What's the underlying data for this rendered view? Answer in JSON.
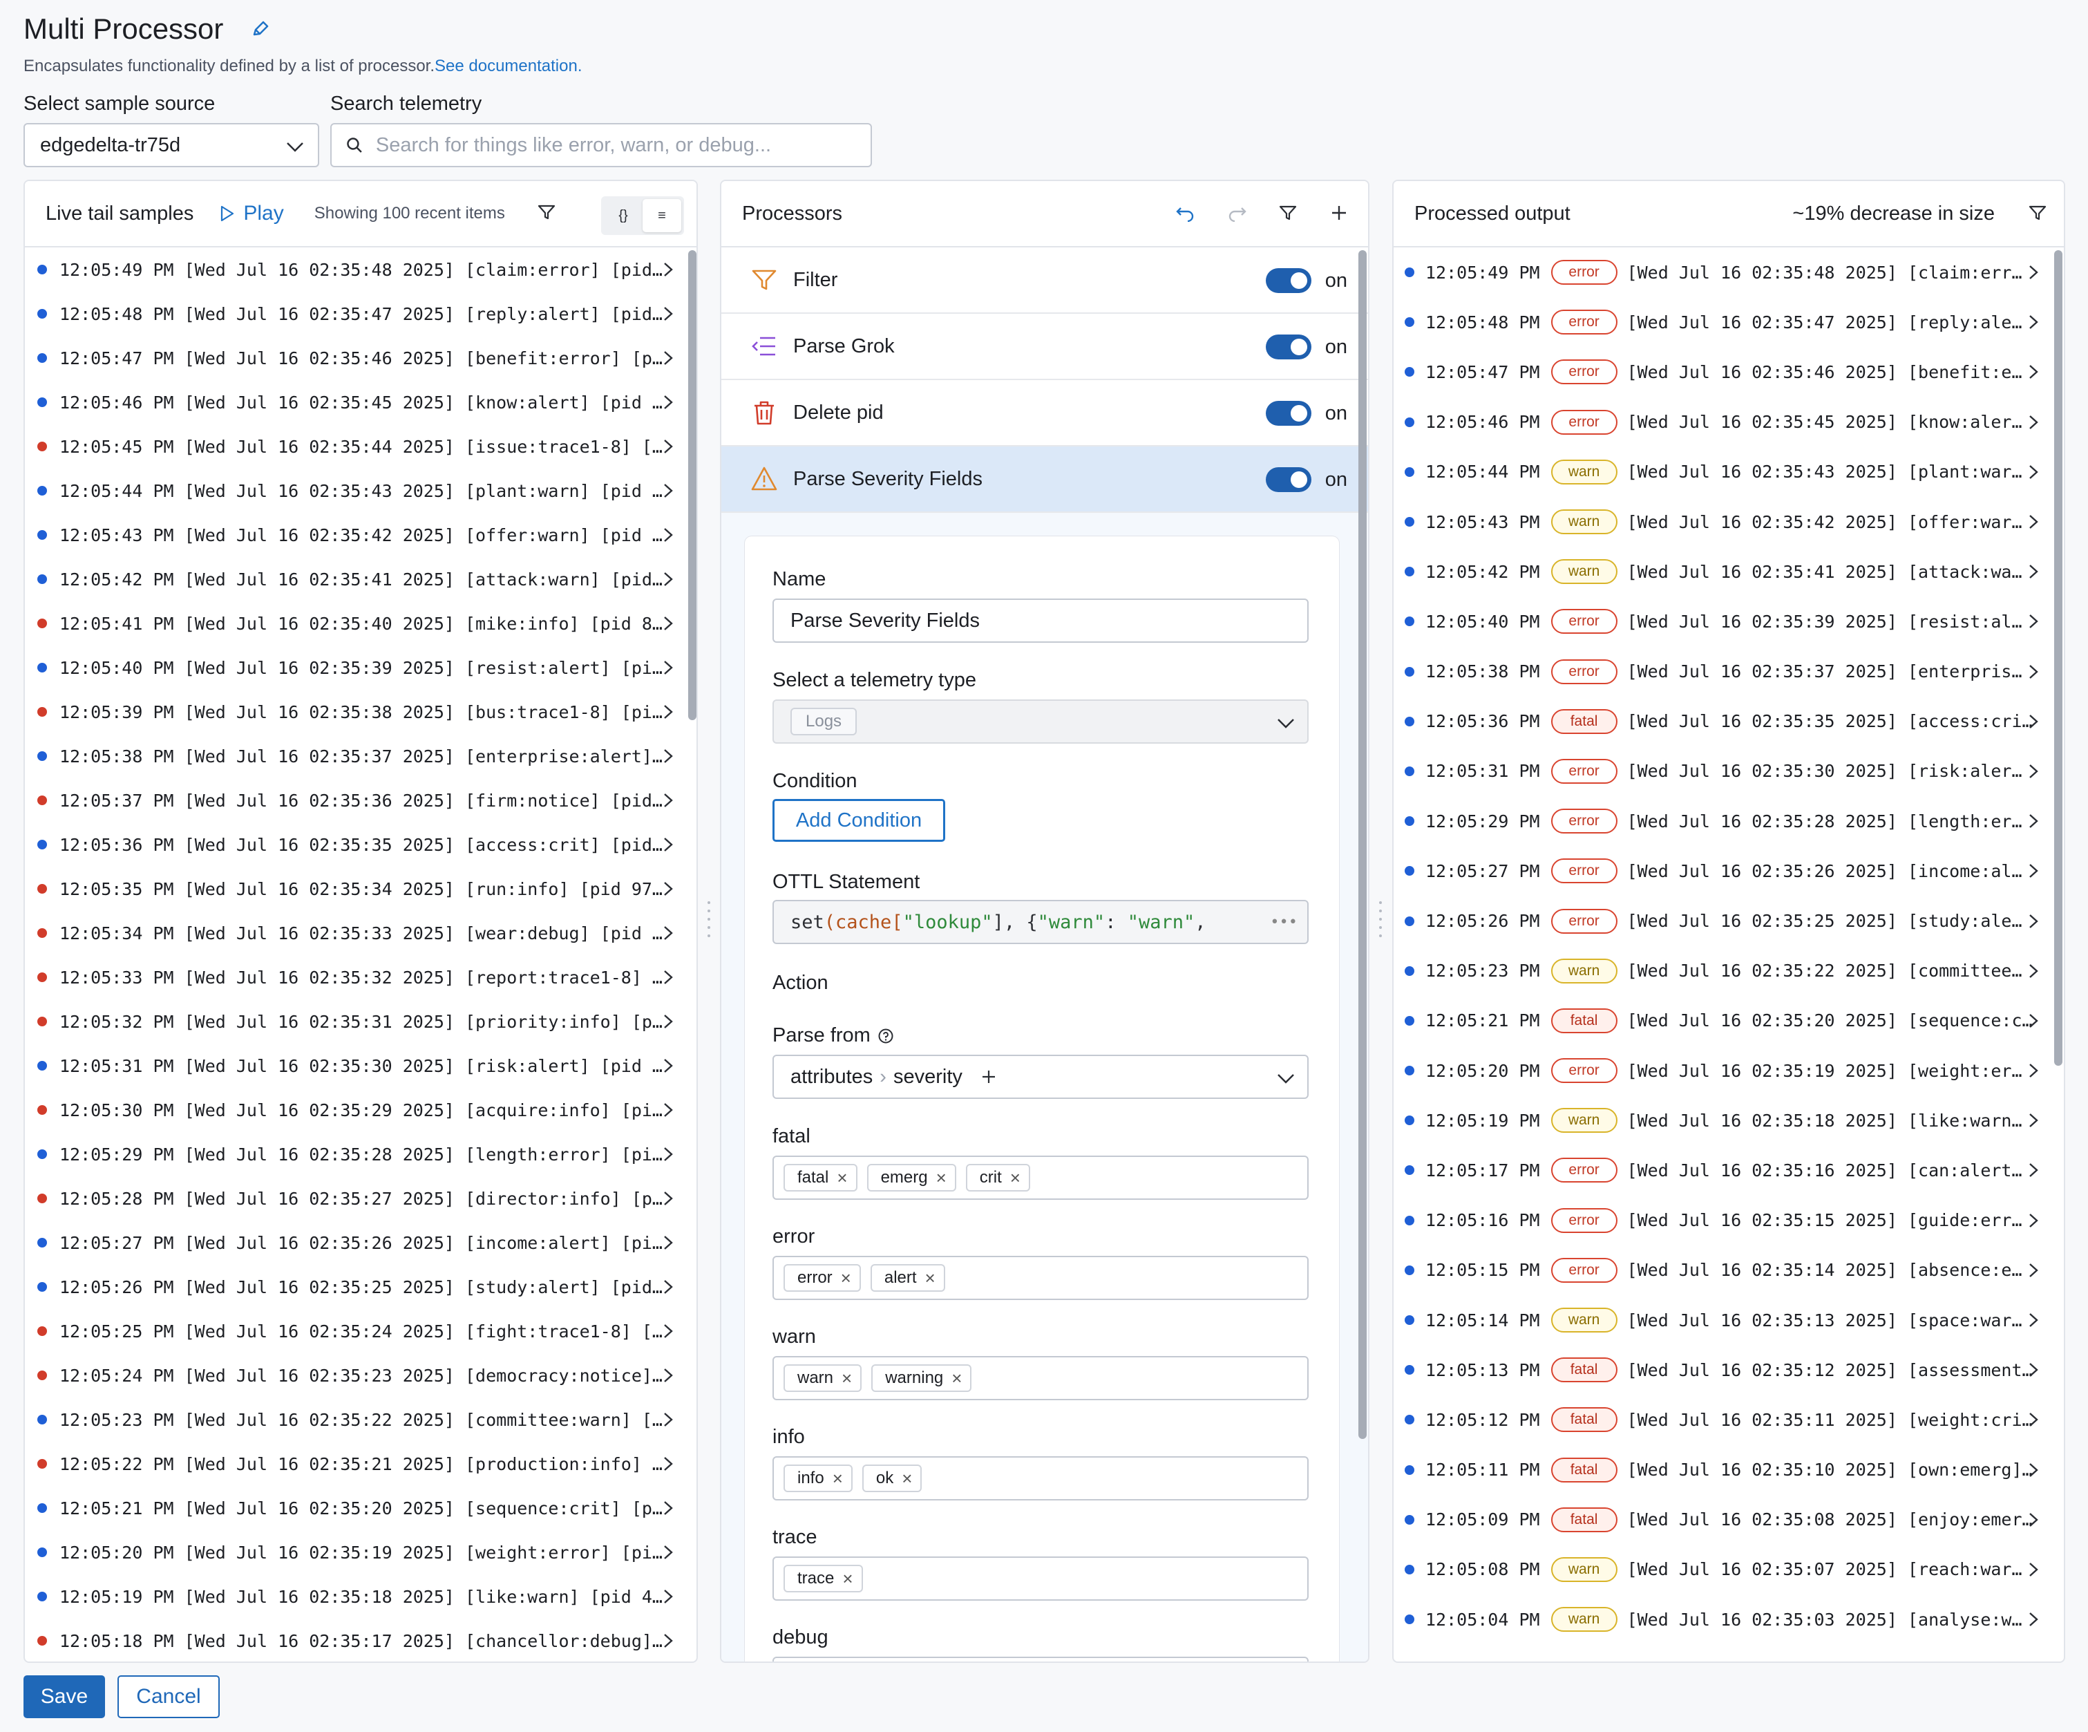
{
  "header": {
    "title": "Multi Processor",
    "subtitle": "Encapsulates functionality defined by a list of processor.",
    "doc_link": "See documentation."
  },
  "source": {
    "label": "Select sample source",
    "value": "edgedelta-tr75d"
  },
  "search": {
    "label": "Search telemetry",
    "placeholder": "Search for things like error, warn, or debug..."
  },
  "live_tail": {
    "title": "Live tail samples",
    "play_label": "Play",
    "recent": "Showing 100 recent items",
    "view_json": "{}",
    "view_text": "≡",
    "rows": [
      {
        "color": "blue",
        "text": "12:05:49 PM [Wed Jul 16 02:35:48 2025] [claim:error] [pid…"
      },
      {
        "color": "blue",
        "text": "12:05:48 PM [Wed Jul 16 02:35:47 2025] [reply:alert] [pid…"
      },
      {
        "color": "blue",
        "text": "12:05:47 PM [Wed Jul 16 02:35:46 2025] [benefit:error] [p…"
      },
      {
        "color": "blue",
        "text": "12:05:46 PM [Wed Jul 16 02:35:45 2025] [know:alert] [pid …"
      },
      {
        "color": "red",
        "text": "12:05:45 PM [Wed Jul 16 02:35:44 2025] [issue:trace1-8] […"
      },
      {
        "color": "blue",
        "text": "12:05:44 PM [Wed Jul 16 02:35:43 2025] [plant:warn] [pid …"
      },
      {
        "color": "blue",
        "text": "12:05:43 PM [Wed Jul 16 02:35:42 2025] [offer:warn] [pid …"
      },
      {
        "color": "blue",
        "text": "12:05:42 PM [Wed Jul 16 02:35:41 2025] [attack:warn] [pid…"
      },
      {
        "color": "red",
        "text": "12:05:41 PM [Wed Jul 16 02:35:40 2025] [mike:info] [pid 8…"
      },
      {
        "color": "blue",
        "text": "12:05:40 PM [Wed Jul 16 02:35:39 2025] [resist:alert] [pi…"
      },
      {
        "color": "red",
        "text": "12:05:39 PM [Wed Jul 16 02:35:38 2025] [bus:trace1-8] [pi…"
      },
      {
        "color": "blue",
        "text": "12:05:38 PM [Wed Jul 16 02:35:37 2025] [enterprise:alert]…"
      },
      {
        "color": "red",
        "text": "12:05:37 PM [Wed Jul 16 02:35:36 2025] [firm:notice] [pid…"
      },
      {
        "color": "blue",
        "text": "12:05:36 PM [Wed Jul 16 02:35:35 2025] [access:crit] [pid…"
      },
      {
        "color": "red",
        "text": "12:05:35 PM [Wed Jul 16 02:35:34 2025] [run:info] [pid 97…"
      },
      {
        "color": "red",
        "text": "12:05:34 PM [Wed Jul 16 02:35:33 2025] [wear:debug] [pid …"
      },
      {
        "color": "red",
        "text": "12:05:33 PM [Wed Jul 16 02:35:32 2025] [report:trace1-8] …"
      },
      {
        "color": "red",
        "text": "12:05:32 PM [Wed Jul 16 02:35:31 2025] [priority:info] [p…"
      },
      {
        "color": "blue",
        "text": "12:05:31 PM [Wed Jul 16 02:35:30 2025] [risk:alert] [pid …"
      },
      {
        "color": "red",
        "text": "12:05:30 PM [Wed Jul 16 02:35:29 2025] [acquire:info] [pi…"
      },
      {
        "color": "blue",
        "text": "12:05:29 PM [Wed Jul 16 02:35:28 2025] [length:error] [pi…"
      },
      {
        "color": "red",
        "text": "12:05:28 PM [Wed Jul 16 02:35:27 2025] [director:info] [p…"
      },
      {
        "color": "blue",
        "text": "12:05:27 PM [Wed Jul 16 02:35:26 2025] [income:alert] [pi…"
      },
      {
        "color": "blue",
        "text": "12:05:26 PM [Wed Jul 16 02:35:25 2025] [study:alert] [pid…"
      },
      {
        "color": "red",
        "text": "12:05:25 PM [Wed Jul 16 02:35:24 2025] [fight:trace1-8] […"
      },
      {
        "color": "red",
        "text": "12:05:24 PM [Wed Jul 16 02:35:23 2025] [democracy:notice]…"
      },
      {
        "color": "blue",
        "text": "12:05:23 PM [Wed Jul 16 02:35:22 2025] [committee:warn] […"
      },
      {
        "color": "red",
        "text": "12:05:22 PM [Wed Jul 16 02:35:21 2025] [production:info] …"
      },
      {
        "color": "blue",
        "text": "12:05:21 PM [Wed Jul 16 02:35:20 2025] [sequence:crit] [p…"
      },
      {
        "color": "blue",
        "text": "12:05:20 PM [Wed Jul 16 02:35:19 2025] [weight:error] [pi…"
      },
      {
        "color": "blue",
        "text": "12:05:19 PM [Wed Jul 16 02:35:18 2025] [like:warn] [pid 4…"
      },
      {
        "color": "red",
        "text": "12:05:18 PM [Wed Jul 16 02:35:17 2025] [chancellor:debug]…"
      }
    ]
  },
  "processors": {
    "title": "Processors",
    "items": [
      {
        "icon": "filter-icon",
        "label": "Filter",
        "state": "on"
      },
      {
        "icon": "parse-grok-icon",
        "label": "Parse Grok",
        "state": "on"
      },
      {
        "icon": "trash-icon",
        "label": "Delete pid",
        "state": "on"
      },
      {
        "icon": "warning-icon",
        "label": "Parse Severity Fields",
        "state": "on"
      }
    ],
    "form": {
      "name_label": "Name",
      "name_value": "Parse Severity Fields",
      "telemetry_label": "Select a telemetry type",
      "telemetry_value": "Logs",
      "condition_label": "Condition",
      "add_condition": "Add Condition",
      "ottl_label": "OTTL Statement",
      "ottl_parts": [
        "set",
        "(cache[",
        "\"lookup\"",
        "], {",
        "\"warn\"",
        ": ",
        "\"warn\"",
        ","
      ],
      "action_label": "Action",
      "parse_from_label": "Parse from",
      "parse_from_path": [
        "attributes",
        "severity"
      ],
      "levels": [
        {
          "label": "fatal",
          "tags": [
            "fatal",
            "emerg",
            "crit"
          ]
        },
        {
          "label": "error",
          "tags": [
            "error",
            "alert"
          ]
        },
        {
          "label": "warn",
          "tags": [
            "warn",
            "warning"
          ]
        },
        {
          "label": "info",
          "tags": [
            "info",
            "ok"
          ]
        },
        {
          "label": "trace",
          "tags": [
            "trace"
          ]
        },
        {
          "label": "debug",
          "tags": []
        }
      ]
    }
  },
  "output": {
    "title": "Processed output",
    "size_change": "~19% decrease in size",
    "rows": [
      {
        "time": "12:05:49 PM",
        "level": "error",
        "text": "[Wed Jul 16 02:35:48 2025] [claim:err…"
      },
      {
        "time": "12:05:48 PM",
        "level": "error",
        "text": "[Wed Jul 16 02:35:47 2025] [reply:ale…"
      },
      {
        "time": "12:05:47 PM",
        "level": "error",
        "text": "[Wed Jul 16 02:35:46 2025] [benefit:e…"
      },
      {
        "time": "12:05:46 PM",
        "level": "error",
        "text": "[Wed Jul 16 02:35:45 2025] [know:aler…"
      },
      {
        "time": "12:05:44 PM",
        "level": "warn",
        "text": "[Wed Jul 16 02:35:43 2025] [plant:war…"
      },
      {
        "time": "12:05:43 PM",
        "level": "warn",
        "text": "[Wed Jul 16 02:35:42 2025] [offer:war…"
      },
      {
        "time": "12:05:42 PM",
        "level": "warn",
        "text": "[Wed Jul 16 02:35:41 2025] [attack:wa…"
      },
      {
        "time": "12:05:40 PM",
        "level": "error",
        "text": "[Wed Jul 16 02:35:39 2025] [resist:al…"
      },
      {
        "time": "12:05:38 PM",
        "level": "error",
        "text": "[Wed Jul 16 02:35:37 2025] [enterpris…"
      },
      {
        "time": "12:05:36 PM",
        "level": "fatal",
        "text": "[Wed Jul 16 02:35:35 2025] [access:cri…"
      },
      {
        "time": "12:05:31 PM",
        "level": "error",
        "text": "[Wed Jul 16 02:35:30 2025] [risk:aler…"
      },
      {
        "time": "12:05:29 PM",
        "level": "error",
        "text": "[Wed Jul 16 02:35:28 2025] [length:er…"
      },
      {
        "time": "12:05:27 PM",
        "level": "error",
        "text": "[Wed Jul 16 02:35:26 2025] [income:al…"
      },
      {
        "time": "12:05:26 PM",
        "level": "error",
        "text": "[Wed Jul 16 02:35:25 2025] [study:ale…"
      },
      {
        "time": "12:05:23 PM",
        "level": "warn",
        "text": "[Wed Jul 16 02:35:22 2025] [committee…"
      },
      {
        "time": "12:05:21 PM",
        "level": "fatal",
        "text": "[Wed Jul 16 02:35:20 2025] [sequence:c…"
      },
      {
        "time": "12:05:20 PM",
        "level": "error",
        "text": "[Wed Jul 16 02:35:19 2025] [weight:er…"
      },
      {
        "time": "12:05:19 PM",
        "level": "warn",
        "text": "[Wed Jul 16 02:35:18 2025] [like:warn…"
      },
      {
        "time": "12:05:17 PM",
        "level": "error",
        "text": "[Wed Jul 16 02:35:16 2025] [can:alert…"
      },
      {
        "time": "12:05:16 PM",
        "level": "error",
        "text": "[Wed Jul 16 02:35:15 2025] [guide:err…"
      },
      {
        "time": "12:05:15 PM",
        "level": "error",
        "text": "[Wed Jul 16 02:35:14 2025] [absence:e…"
      },
      {
        "time": "12:05:14 PM",
        "level": "warn",
        "text": "[Wed Jul 16 02:35:13 2025] [space:war…"
      },
      {
        "time": "12:05:13 PM",
        "level": "fatal",
        "text": "[Wed Jul 16 02:35:12 2025] [assessment…"
      },
      {
        "time": "12:05:12 PM",
        "level": "fatal",
        "text": "[Wed Jul 16 02:35:11 2025] [weight:cri…"
      },
      {
        "time": "12:05:11 PM",
        "level": "fatal",
        "text": "[Wed Jul 16 02:35:10 2025] [own:emerg]…"
      },
      {
        "time": "12:05:09 PM",
        "level": "fatal",
        "text": "[Wed Jul 16 02:35:08 2025] [enjoy:emer…"
      },
      {
        "time": "12:05:08 PM",
        "level": "warn",
        "text": "[Wed Jul 16 02:35:07 2025] [reach:war…"
      },
      {
        "time": "12:05:04 PM",
        "level": "warn",
        "text": "[Wed Jul 16 02:35:03 2025] [analyse:w…"
      }
    ]
  },
  "footer": {
    "save": "Save",
    "cancel": "Cancel"
  },
  "colors": {
    "accent": "#1f73c7",
    "dot_blue": "#1f5fd6",
    "dot_red": "#d13c2a",
    "selected_bg": "#dbe8f8"
  }
}
